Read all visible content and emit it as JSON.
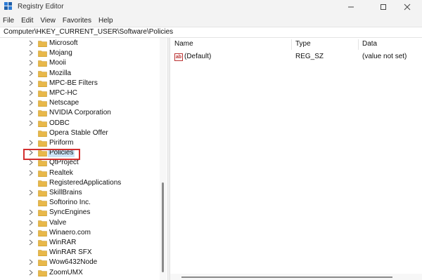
{
  "window": {
    "title": "Registry Editor"
  },
  "menu": [
    "File",
    "Edit",
    "View",
    "Favorites",
    "Help"
  ],
  "address": "Computer\\HKEY_CURRENT_USER\\Software\\Policies",
  "tree": {
    "items": [
      {
        "label": "Microsoft",
        "expandable": true
      },
      {
        "label": "Mojang",
        "expandable": true
      },
      {
        "label": "Mooii",
        "expandable": true
      },
      {
        "label": "Mozilla",
        "expandable": true
      },
      {
        "label": "MPC-BE Filters",
        "expandable": true
      },
      {
        "label": "MPC-HC",
        "expandable": true
      },
      {
        "label": "Netscape",
        "expandable": true
      },
      {
        "label": "NVIDIA Corporation",
        "expandable": true
      },
      {
        "label": "ODBC",
        "expandable": true
      },
      {
        "label": "Opera Stable Offer",
        "expandable": false
      },
      {
        "label": "Piriform",
        "expandable": true
      },
      {
        "label": "Policies",
        "expandable": true,
        "selected": true
      },
      {
        "label": "QtProject",
        "expandable": true
      },
      {
        "label": "Realtek",
        "expandable": true
      },
      {
        "label": "RegisteredApplications",
        "expandable": false
      },
      {
        "label": "SkillBrains",
        "expandable": true
      },
      {
        "label": "Softorino Inc.",
        "expandable": false
      },
      {
        "label": "SyncEngines",
        "expandable": true
      },
      {
        "label": "Valve",
        "expandable": true
      },
      {
        "label": "Winaero.com",
        "expandable": true
      },
      {
        "label": "WinRAR",
        "expandable": true
      },
      {
        "label": "WinRAR SFX",
        "expandable": false
      },
      {
        "label": "Wow6432Node",
        "expandable": true
      },
      {
        "label": "ZoomUMX",
        "expandable": true
      }
    ]
  },
  "values": {
    "columns": {
      "name": "Name",
      "type": "Type",
      "data": "Data"
    },
    "rows": [
      {
        "icon": "ab",
        "name": "(Default)",
        "type": "REG_SZ",
        "data": "(value not set)"
      }
    ]
  },
  "colors": {
    "highlight_border": "#d32f2f",
    "folder": "#e8b84a",
    "selection": "#cce4f7"
  }
}
